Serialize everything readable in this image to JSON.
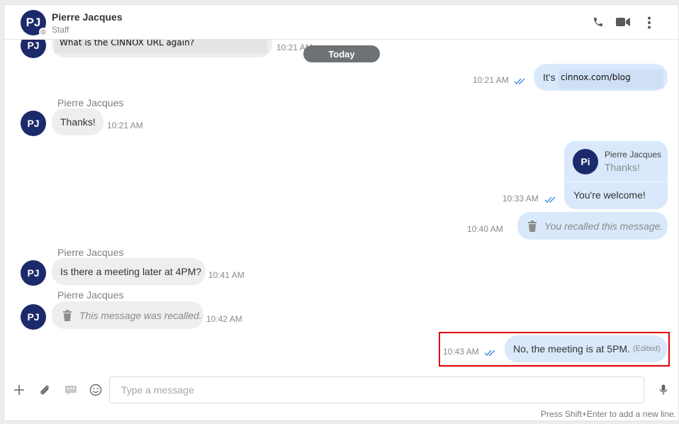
{
  "header": {
    "avatar_initials": "PJ",
    "name": "Pierre Jacques",
    "role": "Staff",
    "icons": [
      "phone-icon",
      "video-camera-icon",
      "more-vertical-icon"
    ]
  },
  "date_divider": "Today",
  "messages": {
    "m0": {
      "text": "What is the CINNOX URL again?",
      "time": "10:21 AM",
      "avatar": "PJ"
    },
    "m1": {
      "prefix": "It's",
      "link": "cinnox.com/blog",
      "time": "10:21 AM"
    },
    "m2": {
      "sender": "Pierre Jacques",
      "text": "Thanks!",
      "time": "10:21 AM",
      "avatar": "PJ"
    },
    "m3": {
      "quote_avatar": "Pi",
      "quote_sender": "Pierre Jacques",
      "quote_text": "Thanks!",
      "text": "You're welcome!",
      "time": "10:33 AM"
    },
    "m4": {
      "text": "You recalled this message.",
      "time": "10:40 AM"
    },
    "m5": {
      "sender": "Pierre Jacques",
      "text": "Is there a meeting later at 4PM?",
      "time": "10:41 AM",
      "avatar": "PJ"
    },
    "m6": {
      "sender": "Pierre Jacques",
      "text": "This message was recalled.",
      "time": "10:42 AM",
      "avatar": "PJ"
    },
    "m7": {
      "text": "No, the meeting is at 5PM.",
      "edited": "(Edited)",
      "time": "10:43 AM"
    }
  },
  "composer": {
    "placeholder": "Type a message",
    "hint": "Press Shift+Enter to add a new line."
  },
  "colors": {
    "avatar": "#1b2a6b",
    "outgoing_bubble": "#d9e9fb",
    "incoming_bubble": "#eeeeee",
    "read_check": "#3a8ee6",
    "highlight_box": "#e00000"
  }
}
